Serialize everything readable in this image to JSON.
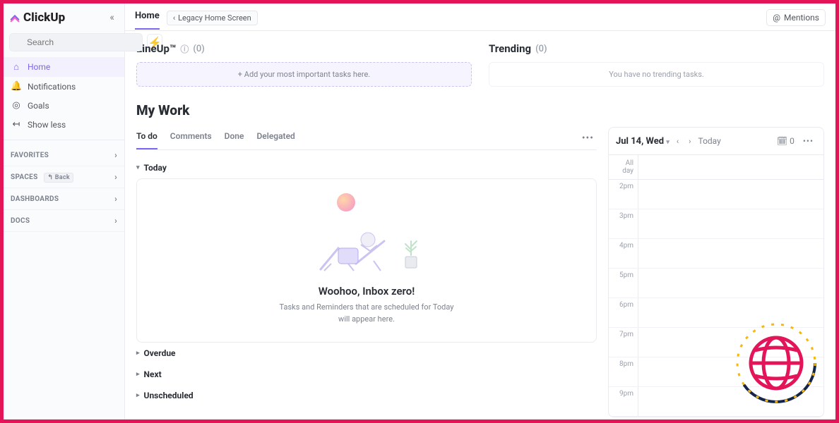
{
  "app_name": "ClickUp",
  "sidebar": {
    "search_placeholder": "Search",
    "nav": [
      {
        "label": "Home",
        "icon": "⌂",
        "active": true
      },
      {
        "label": "Notifications",
        "icon": "🔔",
        "active": false
      },
      {
        "label": "Goals",
        "icon": "◎",
        "active": false
      },
      {
        "label": "Show less",
        "icon": "↤",
        "active": false
      }
    ],
    "sections": [
      {
        "label": "Favorites",
        "badge": null
      },
      {
        "label": "Spaces",
        "badge": "↰ Back"
      },
      {
        "label": "Dashboards",
        "badge": null
      },
      {
        "label": "Docs",
        "badge": null
      }
    ]
  },
  "topbar": {
    "breadcrumb": "Home",
    "legacy_label": "Legacy Home Screen",
    "mentions_label": "Mentions"
  },
  "lineup": {
    "title": "LineUp™",
    "count_text": "(0)",
    "placeholder": "Add your most important tasks here."
  },
  "trending": {
    "title": "Trending",
    "count_text": "(0)",
    "empty_text": "You have no trending tasks."
  },
  "mywork": {
    "title": "My Work",
    "tabs": [
      {
        "label": "To do",
        "active": true
      },
      {
        "label": "Comments",
        "active": false
      },
      {
        "label": "Done",
        "active": false
      },
      {
        "label": "Delegated",
        "active": false
      }
    ],
    "groups": [
      {
        "label": "Today",
        "expanded": true
      },
      {
        "label": "Overdue",
        "expanded": false
      },
      {
        "label": "Next",
        "expanded": false
      },
      {
        "label": "Unscheduled",
        "expanded": false
      }
    ],
    "empty_state": {
      "heading": "Woohoo, Inbox zero!",
      "sub": "Tasks and Reminders that are scheduled for Today will appear here."
    }
  },
  "calendar": {
    "date_label": "Jul 14, Wed",
    "today_label": "Today",
    "count_badge": "0",
    "allday_label": "All day",
    "hours": [
      "2pm",
      "3pm",
      "4pm",
      "5pm",
      "6pm",
      "7pm",
      "8pm",
      "9pm"
    ]
  },
  "colors": {
    "accent": "#7b68ee",
    "border": "#e9ebf0",
    "text": "#292d34",
    "muted": "#7c828d",
    "frame": "#e31558"
  }
}
